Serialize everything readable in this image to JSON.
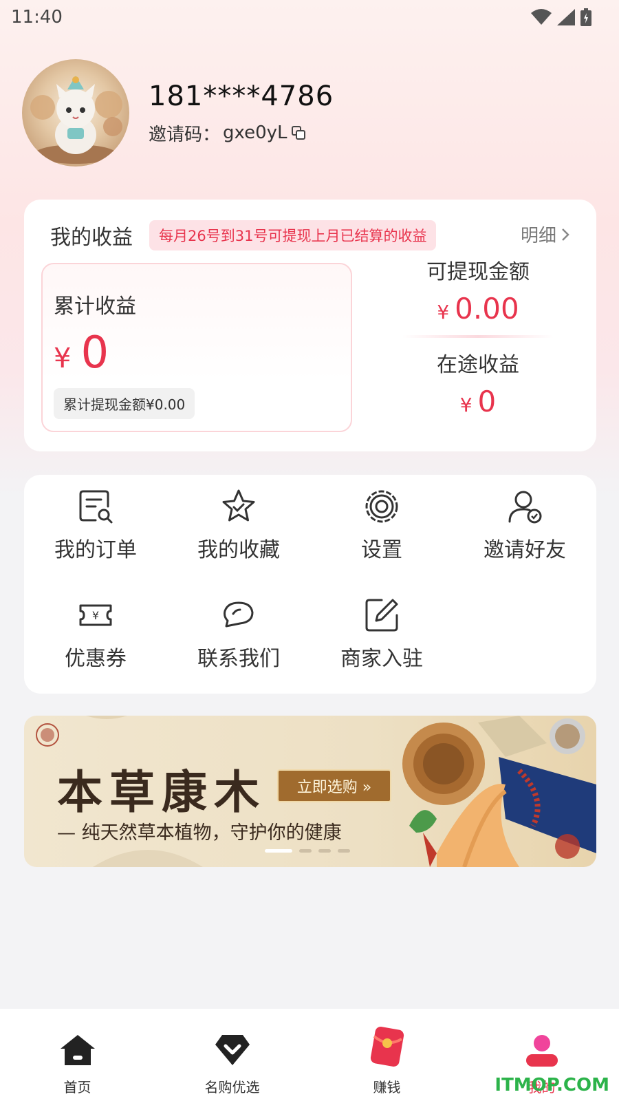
{
  "status_bar": {
    "time": "11:40"
  },
  "profile": {
    "phone": "181****4786",
    "invite_label": "邀请码：",
    "invite_code": "gxe0yL"
  },
  "earnings": {
    "title": "我的收益",
    "notice": "每月26号到31号可提现上月已结算的收益",
    "detail_label": "明细",
    "total_label": "累计收益",
    "total_currency": "¥",
    "total_value": "0",
    "withdrawn_text": "累计提现金额¥0.00",
    "withdrawable_label": "可提现金额",
    "withdrawable_currency": "¥",
    "withdrawable_value": "0.00",
    "pending_label": "在途收益",
    "pending_currency": "¥",
    "pending_value": "0"
  },
  "menu": {
    "items": [
      {
        "label": "我的订单",
        "icon": "order-search-icon"
      },
      {
        "label": "我的收藏",
        "icon": "star-icon"
      },
      {
        "label": "设置",
        "icon": "gear-icon"
      },
      {
        "label": "邀请好友",
        "icon": "user-check-icon"
      },
      {
        "label": "优惠券",
        "icon": "coupon-icon"
      },
      {
        "label": "联系我们",
        "icon": "chat-icon"
      },
      {
        "label": "商家入驻",
        "icon": "edit-icon"
      }
    ]
  },
  "banner": {
    "title": "本草康木",
    "cta": "立即选购 »",
    "subtitle": "— 纯天然草本植物，守护你的健康",
    "active_slide": 1,
    "total_slides": 4
  },
  "tabbar": {
    "items": [
      {
        "label": "首页",
        "icon": "home-icon"
      },
      {
        "label": "名购优选",
        "icon": "diamond-heart-icon"
      },
      {
        "label": "赚钱",
        "icon": "red-envelope-icon"
      },
      {
        "label": "我的",
        "icon": "profile-icon",
        "active": true
      }
    ]
  },
  "watermark": "ITMOP.COM",
  "colors": {
    "accent": "#e8344d",
    "notice_bg": "#fde2e6",
    "active_tab": "#e8344d"
  }
}
